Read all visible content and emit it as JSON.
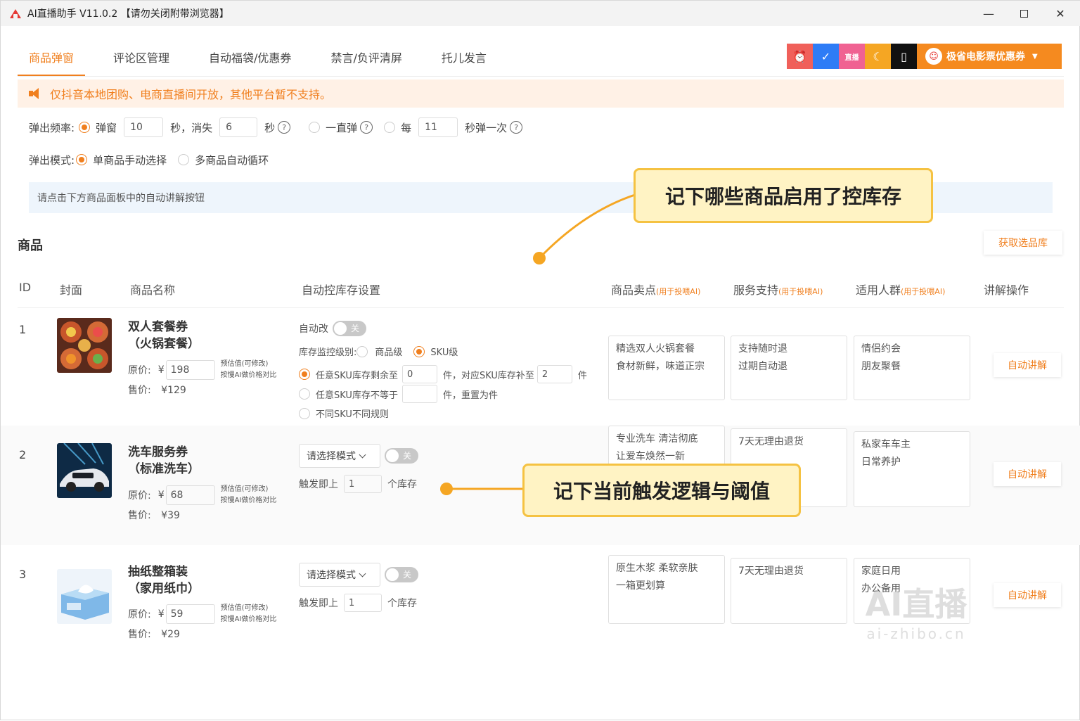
{
  "window": {
    "title": "AI直播助手 V11.0.2 【请勿关闭附带浏览器】",
    "min": "—",
    "close": "✕"
  },
  "tabs": [
    {
      "label": "商品弹窗",
      "active": true
    },
    {
      "label": "评论区管理"
    },
    {
      "label": "自动福袋/优惠券"
    },
    {
      "label": "禁言/负评清屏"
    },
    {
      "label": "托儿发言"
    }
  ],
  "top_icons": [
    {
      "name": "alarm-icon",
      "glyph": "⏰",
      "color": "#f0605a"
    },
    {
      "name": "bird-icon",
      "glyph": "✓",
      "color": "#2e7cf6"
    },
    {
      "name": "tv-icon",
      "glyph": "直播",
      "color": "#f06292"
    },
    {
      "name": "moon-icon",
      "glyph": "☾",
      "color": "#f5a623"
    },
    {
      "name": "phone-icon",
      "glyph": "▯",
      "color": "#111111"
    }
  ],
  "promo": {
    "label": "极省电影票优惠券",
    "icon": "☺"
  },
  "notice": {
    "text": "仅抖音本地团购、电商直播间开放，其他平台暂不支持。"
  },
  "freq": {
    "label": "弹出频率:",
    "opt1": "弹窗",
    "show": "10",
    "unit1": "秒，消失",
    "hide": "6",
    "unit2": "秒",
    "opt2": "一直弹",
    "opt3": "每",
    "interval": "11",
    "unit3": "秒弹一次",
    "help": "?"
  },
  "mode": {
    "label": "弹出模式:",
    "opt1": "单商品手动选择",
    "opt2": "多商品自动循环"
  },
  "hint": "请点击下方商品面板中的自动讲解按钮",
  "section_title": "商品",
  "fetch_button": "获取选品库",
  "table_header": {
    "id": "ID",
    "cover": "封面",
    "name": "商品名称",
    "stock": "自动控库存设置",
    "selling": "商品卖点",
    "service": "服务支持",
    "audience": "适用人群",
    "ai_note": "(用于投喂AI)",
    "action": "讲解操作"
  },
  "labels": {
    "orig": "原价:",
    "sale": "售价:",
    "currency": "¥",
    "est1": "预估值(可修改)",
    "est2": "按慢AI做价格对比",
    "explain": "自动讲解",
    "toggle_off": "关",
    "auto_change": "自动改",
    "monitor": "库存监控级别:",
    "lvl_goods": "商品级",
    "lvl_sku": "SKU级",
    "rule1a": "任意SKU库存剩余至",
    "rule1b": "件，对应SKU库存补至",
    "rule1c": "件",
    "rule2a": "任意SKU库存不等于",
    "rule2b": "件，重置为件",
    "rule3": "不同SKU不同规则",
    "select_mode": "请选择模式",
    "trigger": "触发即上",
    "stock_unit": "个库存"
  },
  "products": [
    {
      "id": "1",
      "name1": "双人套餐券",
      "name2": "（火锅套餐）",
      "orig": "198",
      "sale": "129",
      "rule1_left": "0",
      "rule1_right": "2",
      "selling": [
        "精选双人火锅套餐",
        "食材新鲜，味道正宗"
      ],
      "service": [
        "支持随时退",
        "过期自动退"
      ],
      "audience": [
        "情侣约会",
        "朋友聚餐"
      ]
    },
    {
      "id": "2",
      "name1": "洗车服务券",
      "name2": "（标准洗车）",
      "orig": "68",
      "sale": "39",
      "trigger": "1",
      "selling": [
        "专业洗车 清洁彻底",
        "让爱车焕然一新"
      ],
      "service": [
        "7天无理由退货"
      ],
      "audience": [
        "私家车车主",
        "日常养护"
      ]
    },
    {
      "id": "3",
      "name1": "抽纸整箱装",
      "name2": "（家用纸巾）",
      "orig": "59",
      "sale": "29",
      "trigger": "1",
      "selling": [
        "原生木浆 柔软亲肤",
        "一箱更划算"
      ],
      "service": [
        "7天无理由退货"
      ],
      "audience": [
        "家庭日用",
        "办公备用"
      ]
    }
  ],
  "callouts": {
    "top": "记下哪些商品启用了控库存",
    "mid": "记下当前触发逻辑与阈值"
  },
  "watermark": {
    "big": "AI直播",
    "small": "ai-zhibo.cn"
  }
}
